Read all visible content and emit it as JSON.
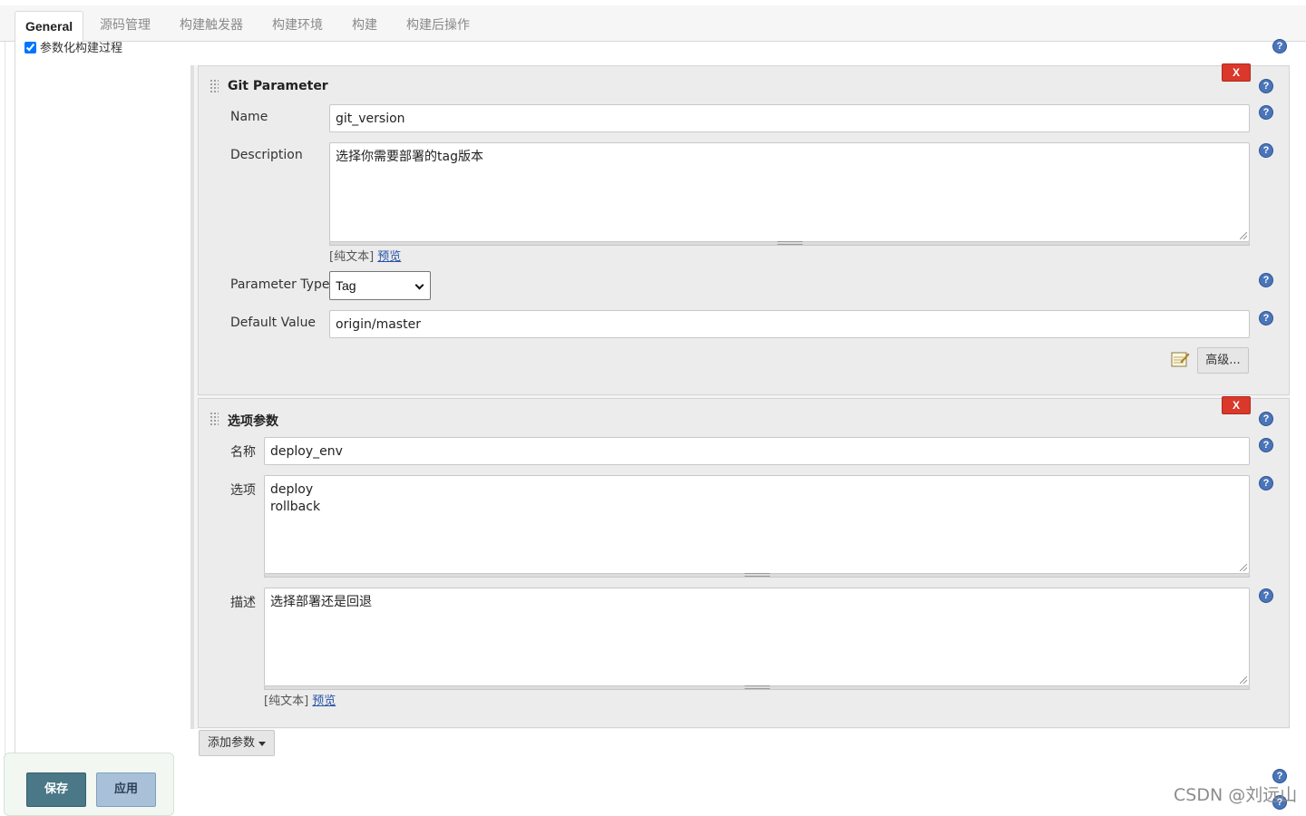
{
  "tabs": [
    "General",
    "源码管理",
    "构建触发器",
    "构建环境",
    "构建",
    "构建后操作"
  ],
  "param_checkbox_label": "参数化构建过程",
  "git_param": {
    "title": "Git Parameter",
    "delete_label": "X",
    "name_label": "Name",
    "name_value": "git_version",
    "desc_label": "Description",
    "desc_value": "选择你需要部署的tag版本",
    "plain_text": "[纯文本]",
    "preview": "预览",
    "ptype_label": "Parameter Type",
    "ptype_value": "Tag",
    "default_label": "Default Value",
    "default_value": "origin/master",
    "advanced_label": "高级..."
  },
  "choice_param": {
    "title": "选项参数",
    "delete_label": "X",
    "name_label": "名称",
    "name_value": "deploy_env",
    "choices_label": "选项",
    "choices_value": "deploy\nrollback",
    "desc_label": "描述",
    "desc_value": "选择部署还是回退",
    "plain_text": "[纯文本]",
    "preview": "预览"
  },
  "add_param_label": "添加参数",
  "save_label": "保存",
  "apply_label": "应用",
  "watermark": "CSDN @刘远山",
  "help_glyph": "?",
  "colors": {
    "delete": "#d9382b",
    "save": "#4a7886",
    "apply": "#a9c1d8",
    "help": "#4b75b9",
    "link": "#2653a6"
  }
}
